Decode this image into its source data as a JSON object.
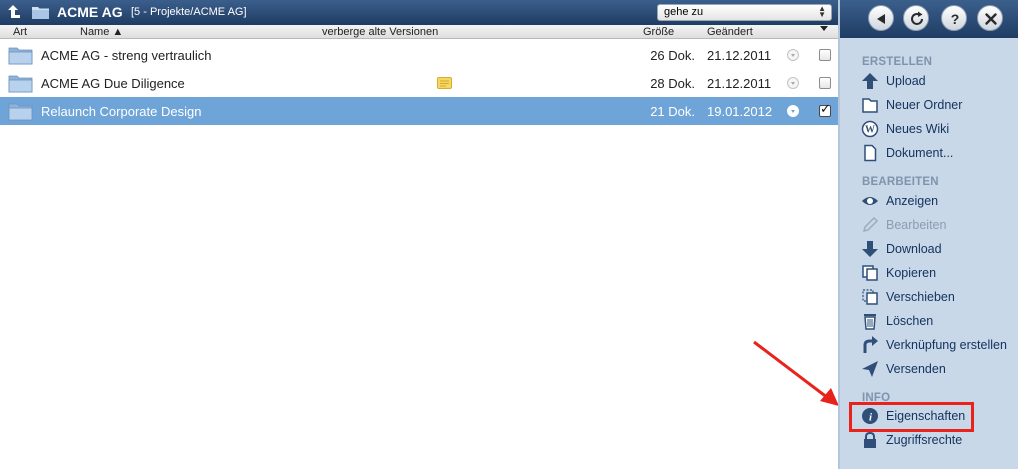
{
  "titlebar": {
    "title": "ACME AG",
    "path": "[5 - Projekte/ACME AG]",
    "goto_value": "gehe zu"
  },
  "columns": {
    "art": "Art",
    "name": "Name ▲",
    "versions": "verberge alte Versionen",
    "size": "Größe",
    "changed": "Geändert"
  },
  "rows": [
    {
      "name": "ACME AG - streng vertraulich",
      "size": "26 Dok.",
      "date": "21.12.2011",
      "selected": false,
      "checked": false
    },
    {
      "name": "ACME AG Due Diligence",
      "size": "28 Dok.",
      "date": "21.12.2011",
      "selected": false,
      "checked": false
    },
    {
      "name": "Relaunch Corporate Design",
      "size": "21 Dok.",
      "date": "19.01.2012",
      "selected": true,
      "checked": true
    }
  ],
  "sidebar": {
    "sections": [
      {
        "title": "ERSTELLEN",
        "items": [
          "Upload",
          "Neuer Ordner",
          "Neues Wiki",
          "Dokument..."
        ]
      },
      {
        "title": "BEARBEITEN",
        "items": [
          "Anzeigen",
          "Bearbeiten",
          "Download",
          "Kopieren",
          "Verschieben",
          "Löschen",
          "Verknüpfung erstellen",
          "Versenden"
        ]
      },
      {
        "title": "INFO",
        "items": [
          "Eigenschaften",
          "Zugriffsrechte"
        ]
      }
    ],
    "disabled_items": [
      "Bearbeiten"
    ],
    "highlighted_item": "Eigenschaften"
  },
  "icons": {
    "top_buttons": [
      "back-icon",
      "refresh-icon",
      "help-icon",
      "close-icon"
    ]
  },
  "colors": {
    "titlebar": "#2b4a74",
    "selection": "#6fa4d8",
    "sidebar_bg": "#c9d8e9",
    "section_heading": "#7f93ad",
    "highlight": "#e8231c"
  }
}
